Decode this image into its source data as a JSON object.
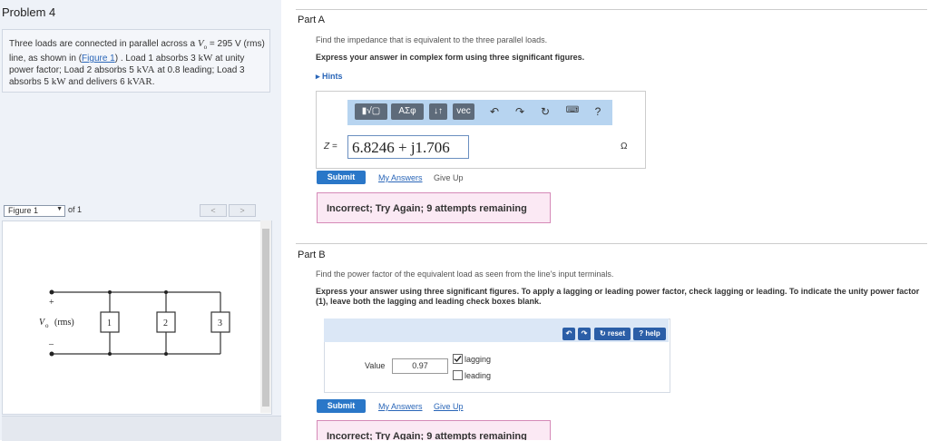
{
  "left": {
    "problem_title": "Problem 4",
    "description": {
      "p1": "Three loads are connected in parallel across a ",
      "v_symbol": "V",
      "v_sub": "o",
      "p2": " = 295  V (rms) line, as shown in (",
      "figure_link": "Figure 1",
      "p3": ") . Load 1 absorbs 3 ",
      "unit_kw": "kW",
      "p4": " at unity power factor; Load 2 absorbs 5 ",
      "unit_kva": "kVA",
      "p5": " at 0.8 leading; Load 3 absorbs 5 ",
      "p6": " and delivers 6 ",
      "unit_kvar": "kVAR",
      "p7": "."
    },
    "figure_select": "Figure 1",
    "figure_of": "of 1",
    "nav_prev": "<",
    "nav_next": ">",
    "circuit": {
      "plus": "+",
      "minus": "–",
      "source_label": "V",
      "source_sub": "o",
      "source_unit": "(rms)",
      "loads": [
        "1",
        "2",
        "3"
      ]
    }
  },
  "partA": {
    "title": "Part A",
    "question": "Find the impedance that is equivalent to the three parallel loads.",
    "instruction": "Express your answer in complex form using three significant figures.",
    "hints": "Hints",
    "toolbar": {
      "btn_templates": "▮√▢",
      "btn_greek": "ΑΣφ",
      "btn_sort": "↓↑",
      "btn_vec": "vec",
      "icons": [
        "undo-icon",
        "redo-icon",
        "reset-icon",
        "keyboard-icon",
        "help-icon"
      ],
      "help": "?"
    },
    "var_label": "Z =",
    "answer_value": "6.8246 + j1.706",
    "unit": "Ω",
    "submit": "Submit",
    "my_answers": "My Answers",
    "give_up": "Give Up",
    "feedback": "Incorrect; Try Again; 9 attempts remaining"
  },
  "partB": {
    "title": "Part B",
    "question": "Find the power factor of the equivalent load as seen from the line's input terminals.",
    "instruction": "Express your answer using three significant figures. To apply a lagging or leading power factor, check lagging or leading. To indicate the unity power factor (1), leave both the lagging and leading check boxes blank.",
    "reset": "reset",
    "help": "help",
    "value_label": "Value",
    "value": "0.97",
    "lagging": "lagging",
    "lagging_checked": true,
    "leading": "leading",
    "leading_checked": false,
    "submit": "Submit",
    "my_answers": "My Answers",
    "give_up": "Give Up",
    "feedback": "Incorrect; Try Again; 9 attempts remaining"
  },
  "colors": {
    "submit_blue": "#2a77c8",
    "toolbar_bg": "#b7d4f0",
    "feedback_bg": "#fbe9f4",
    "feedback_border": "#d58ab8",
    "link_blue": "#2a66b8"
  }
}
